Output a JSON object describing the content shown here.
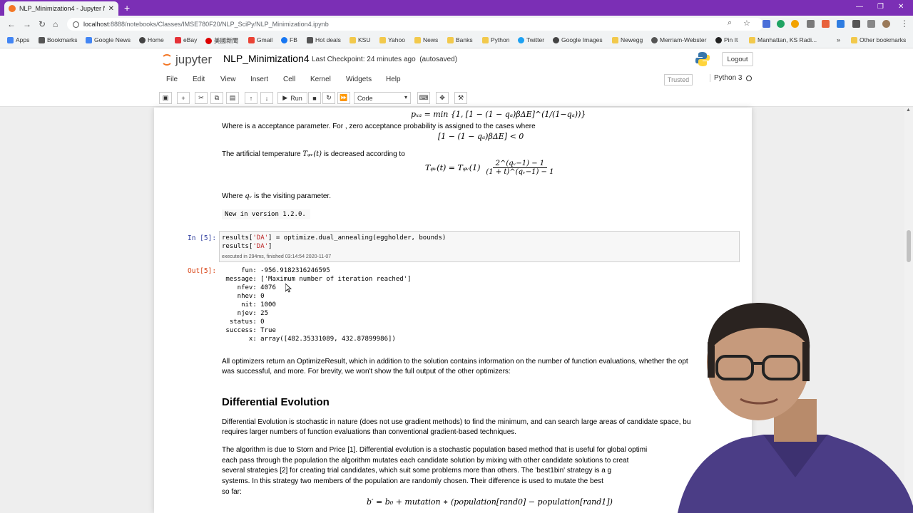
{
  "browser": {
    "tab_title": "NLP_Minimization4 - Jupyter No",
    "url_host": "localhost",
    "url_path": ":8888/notebooks/Classes/IMSE780F20/NLP_SciPy/NLP_Minimization4.ipynb",
    "bookmarks": [
      "Apps",
      "Bookmarks",
      "Google News",
      "Home",
      "eBay",
      "美國新聞",
      "Gmail",
      "FB",
      "Hot deals",
      "KSU",
      "Yahoo",
      "News",
      "Banks",
      "Python",
      "Twitter",
      "Google Images",
      "Newegg",
      "Merriam-Webster",
      "Pin It",
      "Manhattan, KS Radi...",
      "Other bookmarks"
    ]
  },
  "jupyter": {
    "logo_text": "jupyter",
    "notebook_name": "NLP_Minimization4",
    "checkpoint": "Last Checkpoint: 24 minutes ago",
    "autosaved": "(autosaved)",
    "logout": "Logout",
    "menus": [
      "File",
      "Edit",
      "View",
      "Insert",
      "Cell",
      "Kernel",
      "Widgets",
      "Help"
    ],
    "trusted": "Trusted",
    "kernel": "Python 3",
    "run_label": "Run",
    "cell_type": "Code"
  },
  "notebook": {
    "formula_p": "pₓₐ = min {1, [1 − (1 − qₐ)βΔE]^(1/(1−qₐ))}",
    "accept_text": "Where is a acceptance parameter. For , zero acceptance probability is assigned to the cases where",
    "formula_cond": "[1 − (1 − qₐ)βΔE] < 0",
    "temp_text": "The artificial temperature",
    "temp_sym": "Tᵩᵥ(t)",
    "temp_text2": "is decreased according to",
    "formula_T_lhs": "Tᵩᵥ(t) = Tᵩᵥ(1)",
    "formula_T_num": "2^(qᵥ−1) − 1",
    "formula_T_den": "(1 + t)^(qᵥ−1) − 1",
    "visiting_text": "Where",
    "visiting_sym": "qᵥ",
    "visiting_text2": "is the visiting parameter.",
    "new_in_version": "New in version 1.2.0.",
    "in_prompt": "In [5]:",
    "code_line1_a": "results[",
    "code_line1_str": "'DA'",
    "code_line1_b": "] = optimize.dual_annealing(eggholder, bounds)",
    "code_line2_a": "results[",
    "code_line2_str": "'DA'",
    "code_line2_b": "]",
    "exec_info": "executed in 294ms, finished 03:14:54 2020-11-07",
    "out_prompt": "Out[5]:",
    "output": [
      "     fun: -956.9182316246595",
      " message: ['Maximum number of iteration reached']",
      "    nfev: 4076",
      "    nhev: 0",
      "     nit: 1000",
      "    njev: 25",
      "  status: 0",
      " success: True",
      "       x: array([482.35331089, 432.87899986])"
    ],
    "para_optimizers_1": "All optimizers return an OptimizeResult, which in addition to the solution contains information on the number of function evaluations, whether the opt",
    "para_optimizers_2": "was successful, and more. For brevity, we won't show the full output of the other optimizers:",
    "heading_de": "Differential Evolution",
    "para_de_1": "Differential Evolution is stochastic in nature (does not use gradient methods) to find the minimum, and can search large areas of candidate space, bu",
    "para_de_2": "requires larger numbers of function evaluations than conventional gradient-based techniques.",
    "para_alg_1": "The algorithm is due to Storn and Price [1]. Differential evolution is a stochastic population based method that is useful for global optimi",
    "para_alg_2": "each pass through the population the algorithm mutates each candidate solution by mixing with other candidate solutions to creat",
    "para_alg_3": "several strategies [2] for creating trial candidates, which suit some problems more than others. The 'best1bin' strategy is a g",
    "para_alg_4": "systems. In this strategy two members of the population are randomly chosen. Their difference is used to mutate the best",
    "para_alg_5": "so far:",
    "formula_b": "b′ = b₀ + mutation ∗ (population[rand0] − population[rand1])"
  }
}
